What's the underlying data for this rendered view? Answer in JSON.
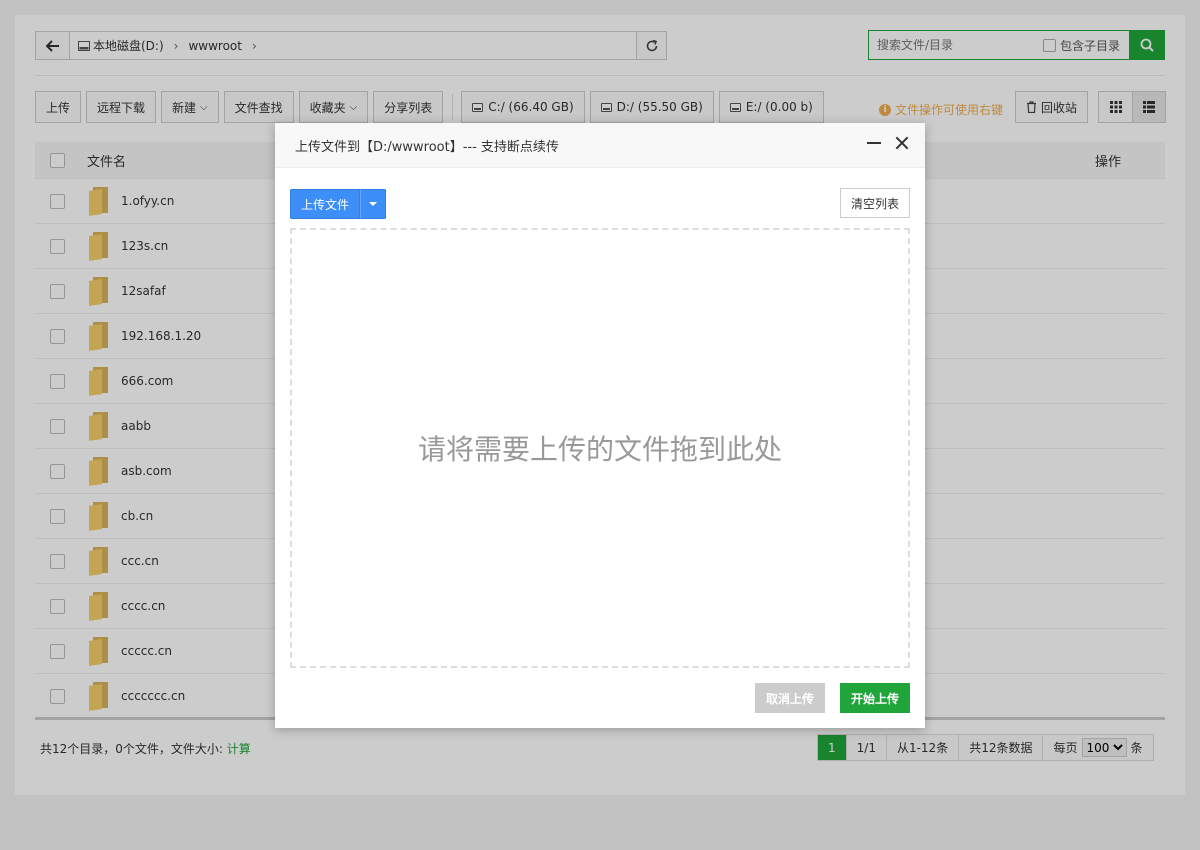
{
  "pathbar": {
    "crumbs": [
      "本地磁盘(D:)",
      "wwwroot"
    ]
  },
  "search": {
    "placeholder": "搜索文件/目录",
    "subdir_label": "包含子目录"
  },
  "toolbar": {
    "upload": "上传",
    "remote_download": "远程下载",
    "new": "新建",
    "file_search": "文件查找",
    "favorites": "收藏夹",
    "share_list": "分享列表",
    "disks": [
      "C:/ (66.40 GB)",
      "D:/ (55.50 GB)",
      "E:/ (0.00 b)"
    ],
    "hint": "文件操作可使用右键",
    "recycle": "回收站"
  },
  "table": {
    "col_name": "文件名",
    "col_ops": "操作",
    "rows": [
      "1.ofyy.cn",
      "123s.cn",
      "12safaf",
      "192.168.1.20",
      "666.com",
      "aabb",
      "asb.com",
      "cb.cn",
      "ccc.cn",
      "cccc.cn",
      "ccccc.cn",
      "ccccccc.cn"
    ]
  },
  "footer": {
    "summary": "共12个目录，0个文件，文件大小: ",
    "calc": "计算"
  },
  "pager": {
    "current": "1",
    "pages": "1/1",
    "range": "从1-12条",
    "total": "共12条数据",
    "per_page_prefix": "每页",
    "per_page_value": "100",
    "per_page_suffix": "条"
  },
  "modal": {
    "title": "上传文件到【D:/wwwroot】--- 支持断点续传",
    "upload_button": "上传文件",
    "clear_button": "清空列表",
    "drop_text": "请将需要上传的文件拖到此处",
    "cancel_button": "取消上传",
    "start_button": "开始上传"
  },
  "colors": {
    "accent_green": "#20a53a",
    "upload_blue": "#3e8ef7",
    "hint_orange": "#f0ad4e"
  }
}
